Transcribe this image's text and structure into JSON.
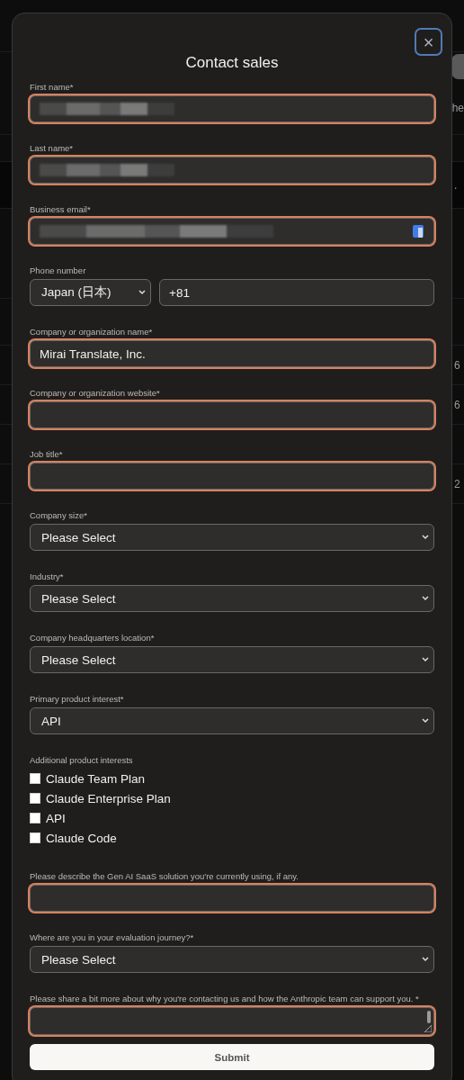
{
  "background": {
    "rows": [
      {
        "kind": "blank"
      },
      {
        "kind": "button"
      },
      {
        "kind": "text",
        "text": "he"
      },
      {
        "kind": "blank"
      },
      {
        "kind": "band",
        "text": "."
      },
      {
        "kind": "blank"
      },
      {
        "kind": "blank"
      },
      {
        "kind": "text",
        "text": "6"
      },
      {
        "kind": "text",
        "text": "6"
      },
      {
        "kind": "blank"
      },
      {
        "kind": "text",
        "text": "2"
      }
    ]
  },
  "dialog": {
    "title": "Contact sales",
    "close": "×",
    "fields": [
      {
        "kind": "text",
        "label": "First name*",
        "redacted": true,
        "invalid": true
      },
      {
        "kind": "text",
        "label": "Last name*",
        "redacted": true,
        "invalid": true
      },
      {
        "kind": "text",
        "label": "Business email*",
        "redacted": true,
        "invalid": true,
        "autofill_icon": true
      },
      {
        "kind": "phone",
        "label": "Phone number",
        "country": "Japan (日本)",
        "value": "+81",
        "invalid": false
      },
      {
        "kind": "text",
        "label": "Company or organization name*",
        "value": "Mirai Translate, Inc.",
        "invalid": true
      },
      {
        "kind": "text",
        "label": "Company or organization website*",
        "invalid": true
      },
      {
        "kind": "text",
        "label": "Job title*",
        "invalid": true
      },
      {
        "kind": "select",
        "label": "Company size*",
        "value": "Please Select",
        "invalid": false
      },
      {
        "kind": "select",
        "label": "Industry*",
        "value": "Please Select",
        "invalid": false
      },
      {
        "kind": "select",
        "label": "Company headquarters location*",
        "value": "Please Select",
        "invalid": false
      },
      {
        "kind": "select",
        "label": "Primary product interest*",
        "value": "API",
        "invalid": false
      },
      {
        "kind": "checkboxes",
        "label": "Additional product interests",
        "options": [
          {
            "label": "Claude Team Plan",
            "checked": false
          },
          {
            "label": "Claude Enterprise Plan",
            "checked": false
          },
          {
            "label": "API",
            "checked": false
          },
          {
            "label": "Claude Code",
            "checked": false
          }
        ]
      },
      {
        "kind": "text",
        "label": "Please describe the Gen AI SaaS solution you're currently using, if any.",
        "invalid": true
      },
      {
        "kind": "select",
        "label": "Where are you in your evaluation journey?*",
        "value": "Please Select",
        "invalid": false
      },
      {
        "kind": "textarea",
        "label": "Please share a bit more about why you're contacting us and how the Anthropic team can support you. *",
        "invalid": true
      }
    ],
    "submit": "Submit"
  }
}
